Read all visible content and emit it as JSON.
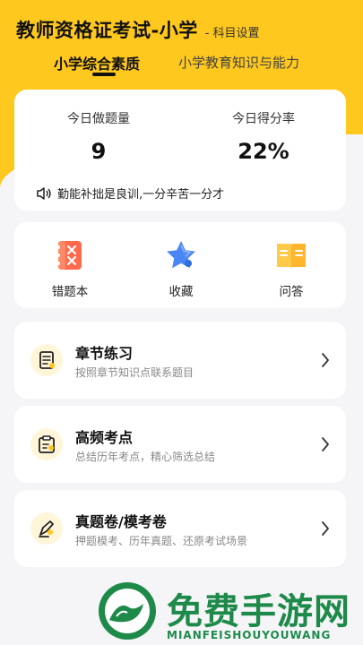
{
  "header": {
    "title": "教师资格证考试-小学",
    "subtitle": "- 科目设置"
  },
  "tabs": [
    {
      "label": "小学综合素质",
      "active": true
    },
    {
      "label": "小学教育知识与能力",
      "active": false
    }
  ],
  "stats": {
    "today_count_label": "今日做题量",
    "today_count_value": "9",
    "today_score_label": "今日得分率",
    "today_score_value": "22%",
    "motto": "勤能补拙是良训,一分辛苦一分才"
  },
  "tools": [
    {
      "label": "错题本",
      "icon": "wrong-book-icon"
    },
    {
      "label": "收藏",
      "icon": "star-icon"
    },
    {
      "label": "问答",
      "icon": "open-book-icon"
    }
  ],
  "menu": [
    {
      "title": "章节练习",
      "desc": "按照章节知识点联系题目",
      "icon": "note-icon"
    },
    {
      "title": "高频考点",
      "desc": "总结历年考点，精心筛选总结",
      "icon": "clipboard-icon"
    },
    {
      "title": "真题卷/模考卷",
      "desc": "押题模考、历年真题、还原考试场景",
      "icon": "pen-icon"
    }
  ],
  "watermark": {
    "text": "免费手游网",
    "sub": "MIANFEISHOUYOUWANG"
  },
  "colors": {
    "accent": "#ffc81e",
    "watermark": "#1e8a4a"
  }
}
